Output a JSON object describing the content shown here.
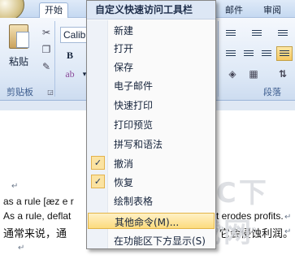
{
  "ribbon": {
    "tabs": [
      {
        "label": "开始",
        "active": true
      },
      {
        "label": "邮件",
        "active": false
      },
      {
        "label": "审阅",
        "active": false
      }
    ],
    "clipboard": {
      "paste_label": "粘贴",
      "group_label": "剪贴板"
    },
    "font": {
      "name_value": "Calib",
      "bold": "B"
    },
    "paragraph": {
      "group_label": "段落"
    }
  },
  "document": {
    "lines": [
      "as a rule  [æz e r",
      "As a rule, deflat",
      "通常来说，通",
      "t erodes profits.",
      "它会侵蚀利润。"
    ],
    "paragraph_mark": "↵"
  },
  "watermark": {
    "text": "PC下载网",
    "url": "www.pcsoft.com.cn"
  },
  "menu": {
    "title": "自定义快速访问工具栏",
    "items": [
      {
        "label": "新建",
        "checked": false,
        "highlighted": false
      },
      {
        "label": "打开",
        "checked": false,
        "highlighted": false
      },
      {
        "label": "保存",
        "checked": false,
        "highlighted": false
      },
      {
        "label": "电子邮件",
        "checked": false,
        "highlighted": false
      },
      {
        "label": "快速打印",
        "checked": false,
        "highlighted": false
      },
      {
        "label": "打印预览",
        "checked": false,
        "highlighted": false
      },
      {
        "label": "拼写和语法",
        "checked": false,
        "highlighted": false
      },
      {
        "label": "撤消",
        "checked": true,
        "highlighted": false
      },
      {
        "label": "恢复",
        "checked": true,
        "highlighted": false
      },
      {
        "label": "绘制表格",
        "checked": false,
        "highlighted": false
      },
      {
        "label": "其他命令(M)...",
        "checked": false,
        "highlighted": true
      },
      {
        "label": "在功能区下方显示(S)",
        "checked": false,
        "highlighted": false
      }
    ],
    "check_glyph": "✓"
  },
  "colors": {
    "menu_highlight": "#fcdb7e",
    "check_bg": "#fbe3a2",
    "ribbon_bg": "#dde8f6",
    "menu_title_bg": "#dde7f5"
  }
}
